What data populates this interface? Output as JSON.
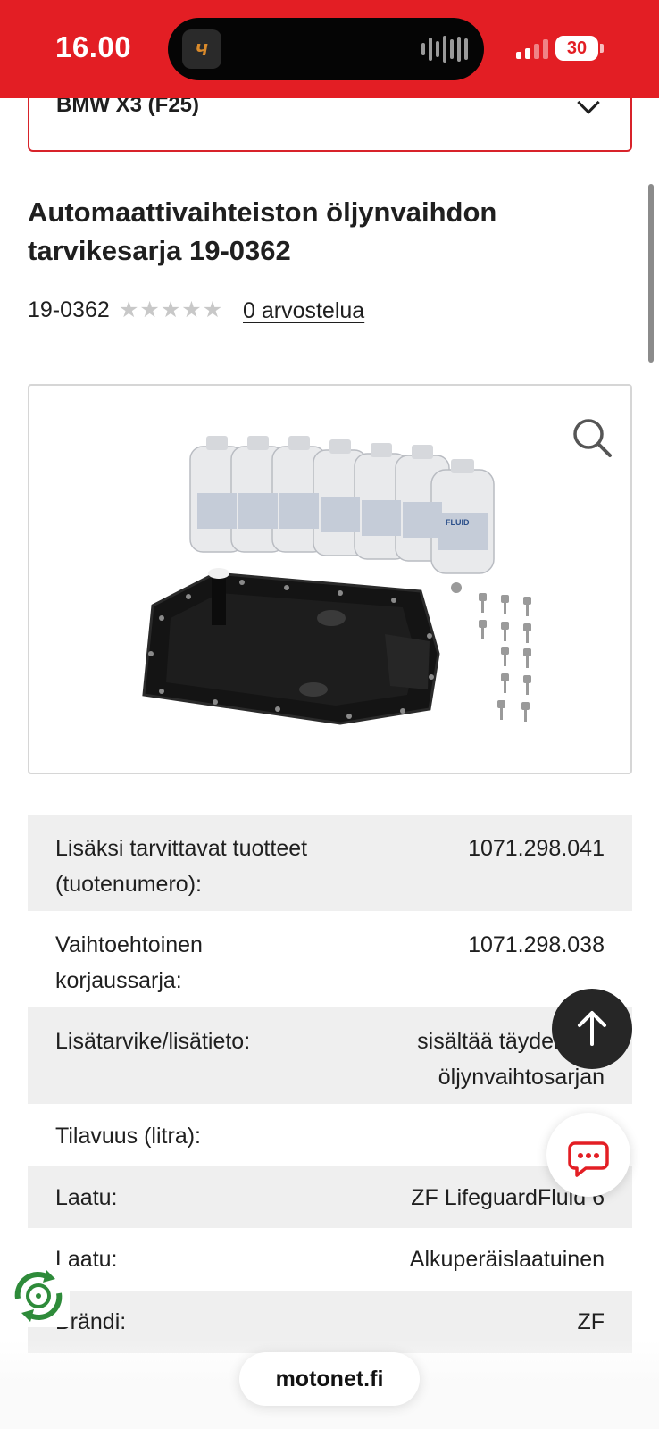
{
  "status_bar": {
    "time": "16.00",
    "island_app_glyph": "ч",
    "battery": "30",
    "colors": {
      "bar": "#e31e24"
    }
  },
  "vehicle": {
    "selected": "BMW X3 (F25)"
  },
  "product": {
    "title": "Automaattivaihteiston öljynvaihdon tarvikesarja 19-0362",
    "sku": "19-0362",
    "rating_stars": 0,
    "rating_max": 5,
    "reviews_label": "0 arvostelua",
    "image_alt": "ZF Lifeguard Fluid -öljypullot, öljypohja ja pultit"
  },
  "specs": [
    {
      "label": "Lisäksi tarvittavat tuotteet (tuotenumero):",
      "value": "1071.298.041"
    },
    {
      "label": "Vaihtoehtoinen korjaussarja:",
      "value": "1071.298.038"
    },
    {
      "label": "Lisätarvike/lisätieto:",
      "value": "sisältää täydellisen öljynvaihtosarjan"
    },
    {
      "label": "Tilavuus (litra):",
      "value": ""
    },
    {
      "label": "Laatu:",
      "value": "ZF LifeguardFluid 6"
    },
    {
      "label": "Laatu:",
      "value": "Alkuperäislaatuinen"
    },
    {
      "label": "Brändi:",
      "value": "ZF"
    }
  ],
  "icons": {
    "zoom": "magnifier-icon",
    "scroll_top": "arrow-up-icon",
    "chat": "chat-bubble-icon",
    "badge": "eco-badge-icon"
  },
  "browser": {
    "url": "motonet.fi"
  },
  "colors": {
    "accent": "#e31e24",
    "shaded_row": "#efefef",
    "dark_button": "#262626",
    "chat_icon": "#e31e24",
    "badge_green": "#2e8b3a"
  }
}
